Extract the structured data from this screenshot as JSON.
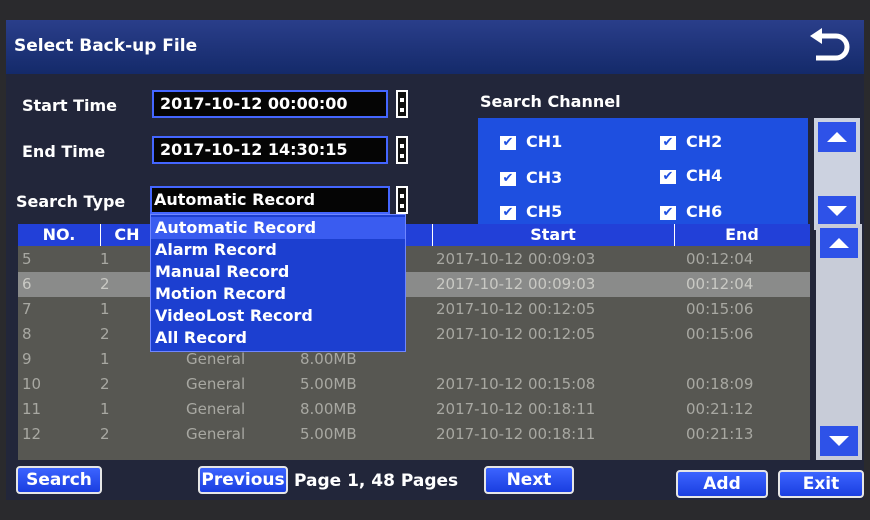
{
  "window": {
    "title": "Select Back-up File",
    "back_icon": "return-arrow-icon"
  },
  "filters": {
    "start_time": {
      "label": "Start Time",
      "value": "2017-10-12 00:00:00"
    },
    "end_time": {
      "label": "End Time",
      "value": "2017-10-12 14:30:15"
    },
    "search_type": {
      "label": "Search Type",
      "value": "Automatic Record"
    }
  },
  "channels": {
    "label": "Search Channel",
    "items": [
      {
        "label": "CH1",
        "checked": true
      },
      {
        "label": "CH2",
        "checked": true
      },
      {
        "label": "CH3",
        "checked": true
      },
      {
        "label": "CH4",
        "checked": true
      },
      {
        "label": "CH5",
        "checked": true
      },
      {
        "label": "CH6",
        "checked": true
      }
    ]
  },
  "dropdown": {
    "options": [
      "Automatic Record",
      "Alarm Record",
      "Manual Record",
      "Motion Record",
      "VideoLost Record",
      "All Record"
    ]
  },
  "table": {
    "columns": [
      "NO.",
      "CH",
      "",
      "Start",
      "End"
    ],
    "rows": [
      {
        "no": "5",
        "ch": "1",
        "type": "",
        "size": "",
        "start": "2017-10-12 00:09:03",
        "end": "00:12:04"
      },
      {
        "no": "6",
        "ch": "2",
        "type": "",
        "size": "",
        "start": "2017-10-12 00:09:03",
        "end": "00:12:04"
      },
      {
        "no": "7",
        "ch": "1",
        "type": "",
        "size": "",
        "start": "2017-10-12 00:12:05",
        "end": "00:15:06"
      },
      {
        "no": "8",
        "ch": "2",
        "type": "",
        "size": "",
        "start": "2017-10-12 00:12:05",
        "end": "00:15:06"
      },
      {
        "no": "9",
        "ch": "1",
        "type": "General",
        "size": "8.00MB",
        "start": "",
        "end": ""
      },
      {
        "no": "10",
        "ch": "2",
        "type": "General",
        "size": "5.00MB",
        "start": "2017-10-12 00:15:08",
        "end": "00:18:09"
      },
      {
        "no": "11",
        "ch": "1",
        "type": "General",
        "size": "8.00MB",
        "start": "2017-10-12 00:18:11",
        "end": "00:21:12"
      },
      {
        "no": "12",
        "ch": "2",
        "type": "General",
        "size": "5.00MB",
        "start": "2017-10-12 00:18:11",
        "end": "00:21:13"
      }
    ]
  },
  "footer": {
    "search": "Search",
    "previous": "Previous",
    "page_info": "Page 1, 48 Pages",
    "next": "Next",
    "add": "Add",
    "exit": "Exit"
  }
}
